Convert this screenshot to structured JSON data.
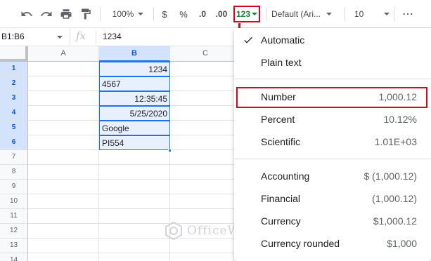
{
  "toolbar": {
    "zoom": "100%",
    "currency_symbol": "$",
    "percent_symbol": "%",
    "decrease_decimal": ".0",
    "increase_decimal": ".00",
    "more_formats": "123",
    "font": "Default (Ari...",
    "font_size": "10",
    "more": "⋯"
  },
  "formula_bar": {
    "range": "B1:B6",
    "fx": "fx",
    "value": "1234"
  },
  "grid": {
    "columns": [
      "A",
      "B",
      "C"
    ],
    "rows": [
      "1",
      "2",
      "3",
      "4",
      "5",
      "6",
      "7",
      "8",
      "9",
      "10",
      "11",
      "12",
      "13",
      "14"
    ],
    "b_cells": [
      "1234",
      "4567",
      "12:35:45",
      "5/25/2020",
      "Google",
      "PI554"
    ]
  },
  "menu": {
    "items": [
      {
        "label": "Automatic",
        "example": "",
        "checked": true
      },
      {
        "label": "Plain text",
        "example": ""
      },
      {
        "label": "Number",
        "example": "1,000.12"
      },
      {
        "label": "Percent",
        "example": "10.12%"
      },
      {
        "label": "Scientific",
        "example": "1.01E+03"
      },
      {
        "label": "Accounting",
        "example": "$ (1,000.12)"
      },
      {
        "label": "Financial",
        "example": "(1,000.12)"
      },
      {
        "label": "Currency",
        "example": "$1,000.12"
      },
      {
        "label": "Currency rounded",
        "example": "$1,000"
      }
    ]
  },
  "watermark": "OfficeWheel",
  "colors": {
    "annotation_red": "#e0001a",
    "selection_blue": "#1a73e8",
    "format_green": "#188038"
  }
}
